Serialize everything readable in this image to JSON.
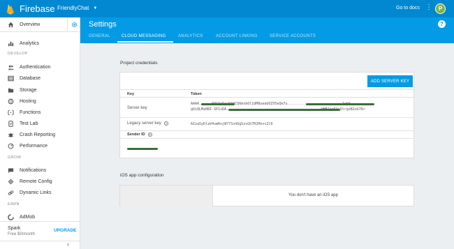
{
  "topbar": {
    "brand": "Firebase",
    "project": "FriendlyChat",
    "docs_link": "Go to docs",
    "avatar_letter": "P"
  },
  "sidebar": {
    "overview": "Overview",
    "analytics": "Analytics",
    "sections": {
      "develop": "DEVELOP",
      "grow": "GROW",
      "earn": "EARN"
    },
    "develop_items": [
      "Authentication",
      "Database",
      "Storage",
      "Hosting",
      "Functions",
      "Test Lab",
      "Crash Reporting",
      "Performance"
    ],
    "grow_items": [
      "Notifications",
      "Remote Config",
      "Dynamic Links"
    ],
    "earn_items": [
      "AdMob"
    ],
    "plan": {
      "name": "Spark",
      "price": "Free $0/month",
      "upgrade": "UPGRADE"
    }
  },
  "header": {
    "title": "Settings",
    "tabs": [
      "GENERAL",
      "CLOUD MESSAGING",
      "ANALYTICS",
      "ACCOUNT LINKING",
      "SERVICE ACCOUNTS"
    ],
    "active_tab": "CLOUD MESSAGING"
  },
  "credentials": {
    "section_title": "Project credentials",
    "add_button": "ADD SERVER KEY",
    "col_key": "Key",
    "col_token": "Token",
    "server_key_label": "Server key",
    "server_key_line1": "AAAA......6RCUuDax8AOCQ6mxbOl1dM8ueaUOZV5eQm7u..........................1rbY",
    "server_key_line2": "gOiQLMa0BI-SP1xDA.............................................WHB2rz5XvStrgzB2oG76r",
    "legacy_label": "Legacy server key",
    "legacy_value": "AIzaSyDlaV4vmKnjW77SxhDgSzvGh7H2Hhzs2l0",
    "sender_label": "Sender ID"
  },
  "ios": {
    "section_title": "iOS app configuration",
    "message": "You don't have an iOS app"
  },
  "colors": {
    "topbar": "#0288d1",
    "header": "#039be5",
    "accent": "#039be5"
  }
}
